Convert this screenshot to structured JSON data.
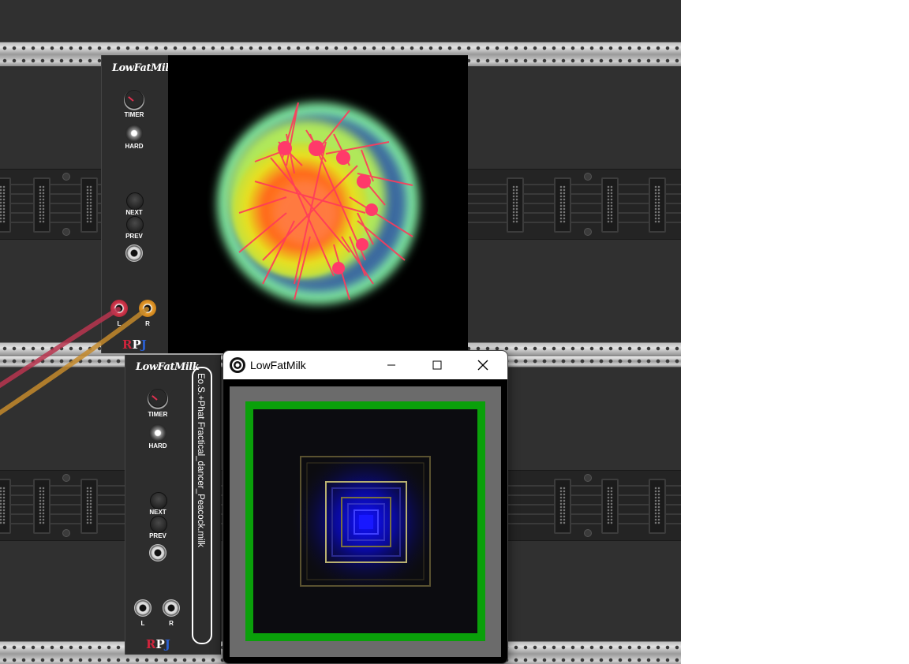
{
  "window": {
    "title": "LowFatMilk",
    "minimize_icon": "minimize-icon",
    "maximize_icon": "maximize-icon",
    "close_icon": "close-icon"
  },
  "module_top": {
    "logo": "LowFatMilk",
    "timer_label": "TIMER",
    "hard_label": "HARD",
    "next_label": "NEXT",
    "prev_label": "PREV",
    "left_label": "L",
    "right_label": "R",
    "brand": "RPJ"
  },
  "module_bottom": {
    "logo": "LowFatMilk",
    "timer_label": "TIMER",
    "hard_label": "HARD",
    "next_label": "NEXT",
    "prev_label": "PREV",
    "left_label": "L",
    "right_label": "R",
    "brand": "RPJ",
    "preset_name": "Eo.S.+Phat Fractical_dancer_Peacock.milk"
  },
  "colors": {
    "cable_red": "#b8354f",
    "cable_orange": "#c48a2c",
    "accent_green": "#0aa00a",
    "rpj_r": "#d0243c",
    "rpj_p": "#ffffff",
    "rpj_j": "#2a5fd0"
  }
}
